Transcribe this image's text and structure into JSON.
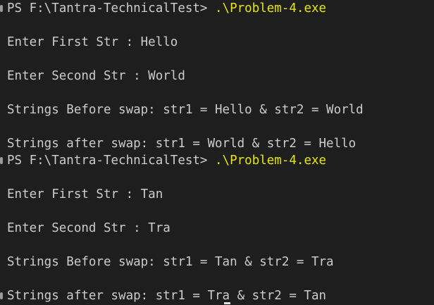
{
  "session1": {
    "prompt": "PS F:\\Tantra-TechnicalTest> ",
    "command": ".\\Problem-4.exe",
    "first_prompt": "Enter First Str : Hello",
    "second_prompt": "Enter Second Str : World",
    "before_swap": "Strings Before swap: str1 = Hello & str2 = World",
    "after_swap": "Strings after swap: str1 = World & str2 = Hello"
  },
  "session2": {
    "prompt": "PS F:\\Tantra-TechnicalTest> ",
    "command": ".\\Problem-4.exe",
    "first_prompt": "Enter First Str : Tan",
    "second_prompt": "Enter Second Str : Tra",
    "before_swap": "Strings Before swap: str1 = Tan & str2 = Tra",
    "after_swap": "Strings after swap: str1 = Tra & str2 = Tan"
  },
  "colors": {
    "background": "#1e1e1e",
    "text": "#cccccc",
    "command": "#e5e510"
  }
}
